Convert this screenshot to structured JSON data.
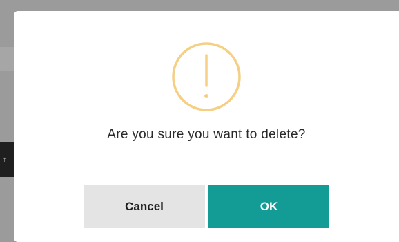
{
  "background_handle": {
    "glyph": "↑"
  },
  "dialog": {
    "icon": "exclamation-circle-icon",
    "message": "Are you sure you want to delete?",
    "cancel_label": "Cancel",
    "ok_label": "OK",
    "colors": {
      "icon": "#f4cf84",
      "ok_button": "#139c96",
      "cancel_button": "#e4e4e4",
      "overlay": "#9b9b9b"
    }
  }
}
